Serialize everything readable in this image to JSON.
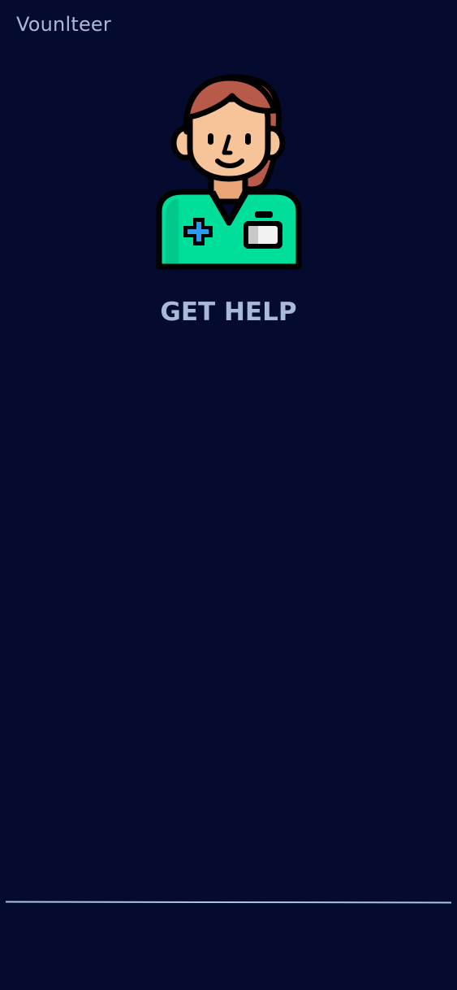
{
  "app": {
    "title": "Vounlteer"
  },
  "hero": {
    "icon": "nurse-avatar-icon"
  },
  "action": {
    "get_help_label": "GET HELP"
  },
  "colors": {
    "background": "#040b2e",
    "text": "#a9b9d9",
    "divider": "#a9c4e8",
    "scrubs": "#00df9a",
    "hair": "#b85a4a",
    "skin": "#f7c49a",
    "cross": "#2b9bf0"
  }
}
